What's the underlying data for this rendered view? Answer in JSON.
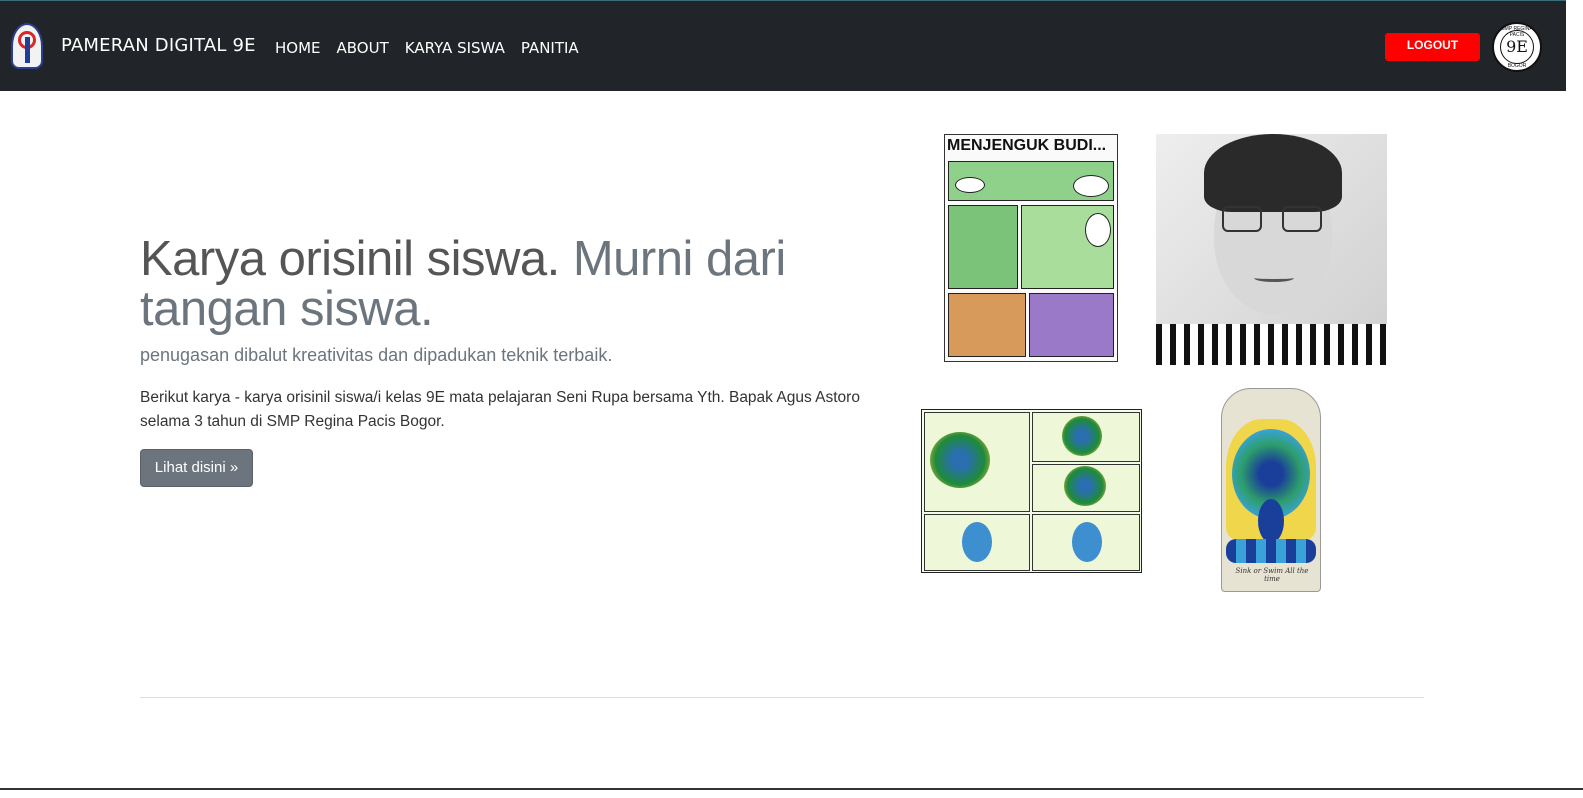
{
  "navbar": {
    "brand": "PAMERAN DIGITAL 9E",
    "links": [
      "HOME",
      "ABOUT",
      "KARYA SISWA",
      "PANITIA"
    ],
    "logout_label": "LOGOUT",
    "school_logo_text": "9E",
    "school_logo_top": "SMP REGINA PACIS",
    "school_logo_bottom": "BOGOR"
  },
  "hero": {
    "heading_main": "Karya orisinil siswa.",
    "heading_muted": "Murni dari tangan siswa.",
    "lead": "penugasan dibalut kreativitas dan dipadukan teknik terbaik.",
    "description": "Berikut karya - karya orisinil siswa/i kelas 9E mata pelajaran Seni Rupa bersama Yth. Bapak Agus Astoro selama 3 tahun di SMP Regina Pacis Bogor.",
    "button_label": "Lihat disini »"
  },
  "gallery": {
    "comic_title": "MENJENGUK BUDI...",
    "board_caption": "Sink or Swim All the time"
  },
  "colors": {
    "navbar_bg": "#212529",
    "logout_bg": "#fe0000",
    "button_bg": "#6c757d"
  }
}
